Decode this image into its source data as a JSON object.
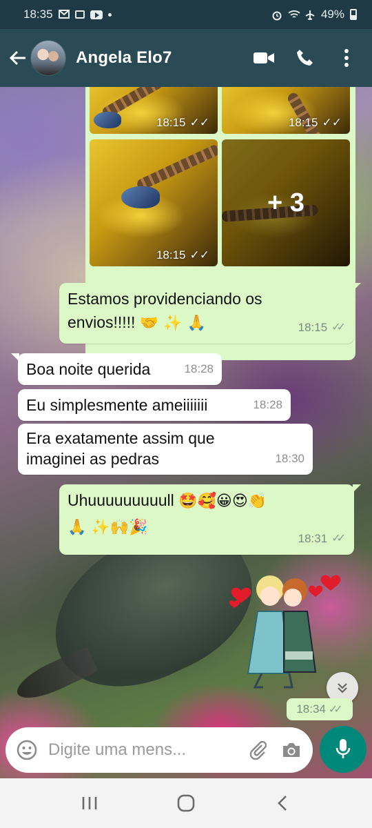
{
  "status_bar": {
    "time": "18:35",
    "battery": "49%",
    "icons": [
      "gmail-icon",
      "gallery-icon",
      "youtube-icon",
      "dot-icon",
      "alarm-icon",
      "wifi-icon",
      "airplane-icon",
      "battery-icon"
    ]
  },
  "header": {
    "contact_name": "Angela Elo7",
    "actions": [
      "video-call-icon",
      "voice-call-icon",
      "more-options-icon"
    ]
  },
  "chat": {
    "photo_album": {
      "times": [
        "18:15",
        "18:15",
        "18:15"
      ],
      "more_count": "+ 3"
    },
    "messages": [
      {
        "dir": "out",
        "text": "Estamos providenciando os envios!!!!! 🤝✨🙏",
        "line1": "Estamos providenciando os",
        "line2": "envios!!!!! ",
        "emojis": "🤝 ✨ 🙏",
        "time": "18:15",
        "status": "read"
      },
      {
        "dir": "in",
        "text": "Boa noite querida",
        "time": "18:28"
      },
      {
        "dir": "in",
        "text": "Eu simplesmente ameiiiiiii",
        "time": "18:28"
      },
      {
        "dir": "in",
        "line1": "Era exatamente assim que",
        "line2": "imaginei as pedras",
        "time": "18:30"
      },
      {
        "dir": "out",
        "line1": "Uhuuuuuuuuull ",
        "line1_emojis": "🤩🥰😀😍👏",
        "line2_emojis": "🙏 ✨🙌🎉",
        "time": "18:31",
        "status": "read"
      }
    ],
    "sticker": {
      "time": "18:34",
      "status": "read"
    }
  },
  "composer": {
    "placeholder": "Digite uma mens...",
    "icons": [
      "emoji-icon",
      "attach-icon",
      "camera-icon",
      "microphone-icon"
    ]
  },
  "colors": {
    "header": "#2a4b55",
    "status_bar": "#1f3a44",
    "outgoing_bubble": "#dcf8c6",
    "incoming_bubble": "#ffffff",
    "accent": "#00897b"
  }
}
